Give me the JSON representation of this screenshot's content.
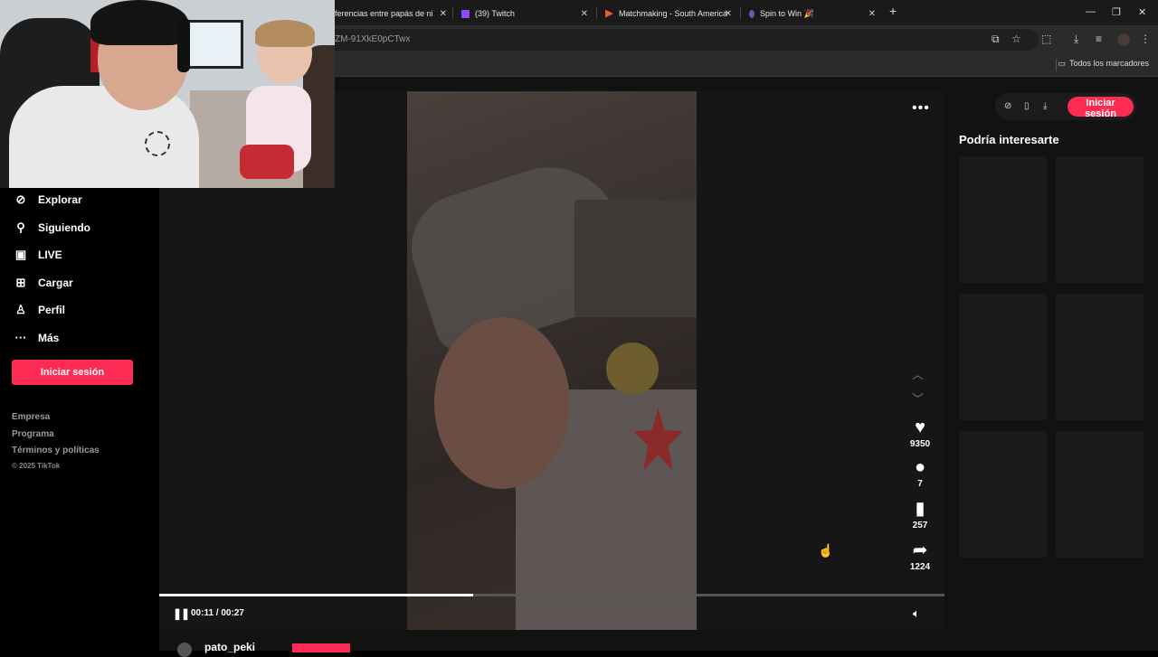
{
  "browser": {
    "tabs": [
      {
        "label": "iferencias entre papás de niñ",
        "icon": "page-icon"
      },
      {
        "label": "(39) Twitch",
        "icon": "twitch-icon"
      },
      {
        "label": "Matchmaking - South America",
        "icon": "game-icon"
      },
      {
        "label": "Spin to Win 🎉",
        "icon": "page-icon"
      }
    ],
    "new_tab": "+",
    "url": "ZM-91XkE0pCTwx",
    "bookmarks_all": "Todos los marcadores"
  },
  "sidebar": {
    "items": [
      {
        "label": "Explorar",
        "icon": "compass-icon"
      },
      {
        "label": "Siguiendo",
        "icon": "user-follow-icon"
      },
      {
        "label": "LIVE",
        "icon": "live-tv-icon"
      },
      {
        "label": "Cargar",
        "icon": "upload-icon"
      },
      {
        "label": "Perfil",
        "icon": "person-icon"
      },
      {
        "label": "Más",
        "icon": "more-icon"
      }
    ],
    "login_label": "Iniciar sesión",
    "footer": [
      "Empresa",
      "Programa",
      "Términos y políticas"
    ],
    "copyright": "© 2025 TikTok"
  },
  "player": {
    "likes": "9350",
    "comments": "7",
    "saves": "257",
    "shares": "1224",
    "time": "00:11 / 00:27",
    "progress": 0.4,
    "author": "pato_peki"
  },
  "right": {
    "login_label": "Iniciar sesión",
    "recommend_title": "Podría interesarte"
  },
  "colors": {
    "accent": "#fe2c55",
    "background": "#121212"
  }
}
